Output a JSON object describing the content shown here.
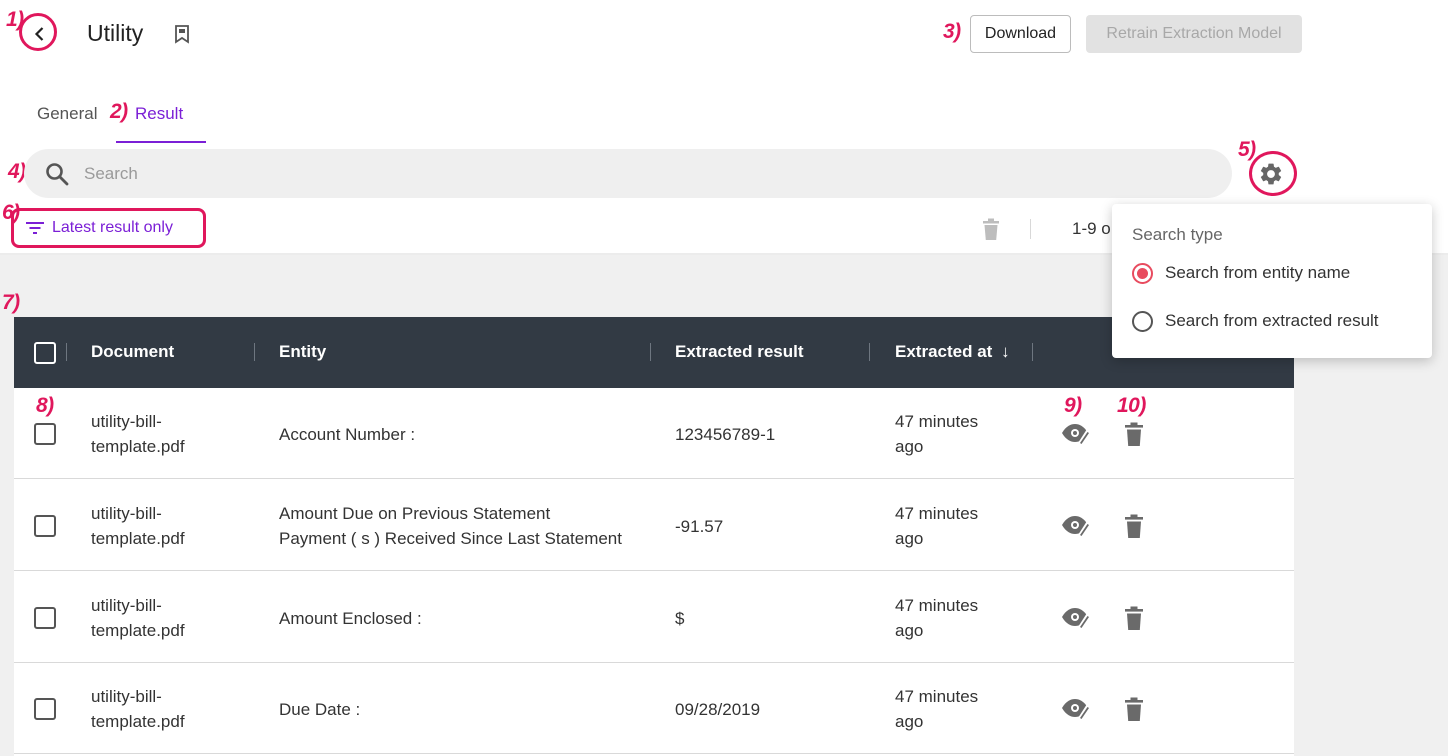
{
  "header": {
    "title": "Utility",
    "download_label": "Download",
    "retrain_label": "Retrain Extraction Model"
  },
  "tabs": [
    {
      "label": "General",
      "active": false
    },
    {
      "label": "Result",
      "active": true
    }
  ],
  "search": {
    "placeholder": "Search"
  },
  "filter": {
    "label": "Latest result only",
    "range_text": "1-9 o"
  },
  "table": {
    "columns": [
      "Document",
      "Entity",
      "Extracted result",
      "Extracted at"
    ],
    "sort_indicator": "↓",
    "rows": [
      {
        "document": [
          "utility-bill-",
          "template.pdf"
        ],
        "entity": [
          "Account Number :"
        ],
        "result": "123456789-1",
        "time": [
          "47 minutes",
          "ago"
        ]
      },
      {
        "document": [
          "utility-bill-",
          "template.pdf"
        ],
        "entity": [
          "Amount Due on Previous Statement",
          "Payment ( s ) Received Since Last Statement"
        ],
        "result": "-91.57",
        "time": [
          "47 minutes",
          "ago"
        ]
      },
      {
        "document": [
          "utility-bill-",
          "template.pdf"
        ],
        "entity": [
          "Amount Enclosed :"
        ],
        "result": "$",
        "time": [
          "47 minutes",
          "ago"
        ]
      },
      {
        "document": [
          "utility-bill-",
          "template.pdf"
        ],
        "entity": [
          "Due Date :"
        ],
        "result": "09/28/2019",
        "time": [
          "47 minutes",
          "ago"
        ]
      }
    ]
  },
  "search_type_popup": {
    "title": "Search type",
    "options": [
      {
        "label": "Search from entity name",
        "selected": true
      },
      {
        "label": "Search from extracted result",
        "selected": false
      }
    ]
  },
  "annotations": [
    "1)",
    "2)",
    "3)",
    "4)",
    "5)",
    "6)",
    "7)",
    "8)",
    "9)",
    "10)"
  ],
  "colors": {
    "accent": "#7b1fd6",
    "annotation": "#e0175c",
    "table_header": "#323a44",
    "radio_selected": "#e84b5f"
  },
  "icons": [
    "chevron-left-icon",
    "bookmark-icon",
    "search-icon",
    "gear-icon",
    "filter-icon",
    "trash-icon",
    "eye-edit-icon",
    "sort-down-icon"
  ]
}
